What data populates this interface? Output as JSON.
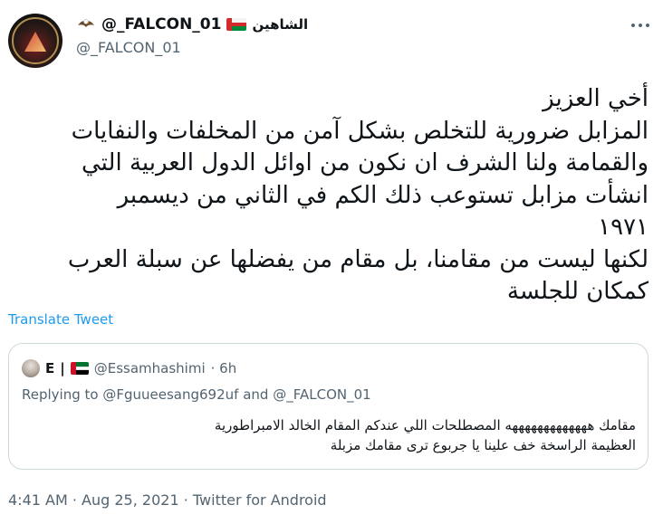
{
  "author": {
    "display_name": "@_FALCON_01",
    "arabic_name": "الشاهين",
    "handle": "@_FALCON_01",
    "avatar_icon": "falcon-emblem-avatar",
    "badges": [
      "eagle-icon",
      "oman-flag-icon"
    ]
  },
  "tweet": {
    "lines": [
      "أخي العزيز",
      "المزابل ضرورية للتخلص بشكل آمن من المخلفات والنفايات",
      "والقمامة ولنا الشرف ان نكون من اوائل الدول العربية التي",
      "انشأت مزابل تستوعب ذلك الكم في الثاني من ديسمبر",
      "١٩٧١",
      "لكنها ليست من مقامنا، بل مقام من يفضلها عن سبلة العرب",
      "كمكان للجلسة"
    ],
    "translate_label": "Translate Tweet"
  },
  "quote": {
    "name": "E",
    "separator": "|",
    "flag_icon": "uae-flag-icon",
    "handle": "@Essamhashimi",
    "time": "· 6h",
    "replying_prefix": "Replying to",
    "mention_1": "@Fguueesang692uf",
    "and_word": "and",
    "mention_2": "@_FALCON_01",
    "lines": [
      "مقامك هههههههههههههه المصطلحات اللي عندكم المقام الخالد الامبراطورية",
      "العظيمة الراسخة خف علينا يا جربوع ترى مقامك مزبلة"
    ]
  },
  "footer": {
    "time": "4:41 AM",
    "dot1": "·",
    "date": "Aug 25, 2021",
    "dot2": "·",
    "source": "Twitter for Android"
  },
  "colors": {
    "link": "#1d9bf0",
    "muted": "#536471",
    "text": "#0f1419",
    "border": "#cfd9de"
  }
}
